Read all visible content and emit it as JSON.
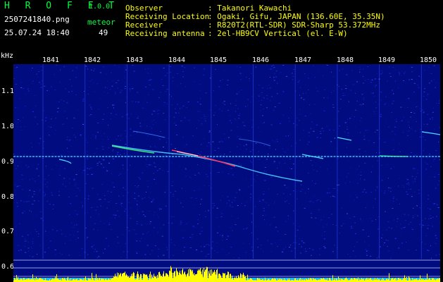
{
  "header": {
    "title": "H R O F F T",
    "version": "1.0.0",
    "file_name": "2507241840.png",
    "datetime": "25.07.24 18:40",
    "meteor_label": "meteor",
    "meteor_count": "49"
  },
  "info": {
    "rows": [
      {
        "label": "Observer",
        "value": ": Takanori Kawachi"
      },
      {
        "label": "Receiving Location",
        "value": ": Ogaki, Gifu, JAPAN (136.60E, 35.35N)"
      },
      {
        "label": "Receiver",
        "value": ": R820T2(RTL-SDR) SDR-Sharp 53.372MHz"
      },
      {
        "label": "Receiving antenna",
        "value": ": 2el-HB9CV Vertical (el. E-W)"
      }
    ]
  },
  "axes": {
    "y_unit": "kHz",
    "x_ticks": [
      "1841",
      "1842",
      "1843",
      "1844",
      "1845",
      "1846",
      "1847",
      "1848",
      "1849",
      "1850"
    ],
    "y_ticks": [
      "1.1",
      "1.0",
      "0.9",
      "0.8",
      "0.7",
      "0.6"
    ]
  },
  "colors": {
    "background": "#000c80",
    "carrier": "#3fd0ff",
    "echo_hot": "#ff3060",
    "amplitude_bar": "#ffff00"
  }
}
